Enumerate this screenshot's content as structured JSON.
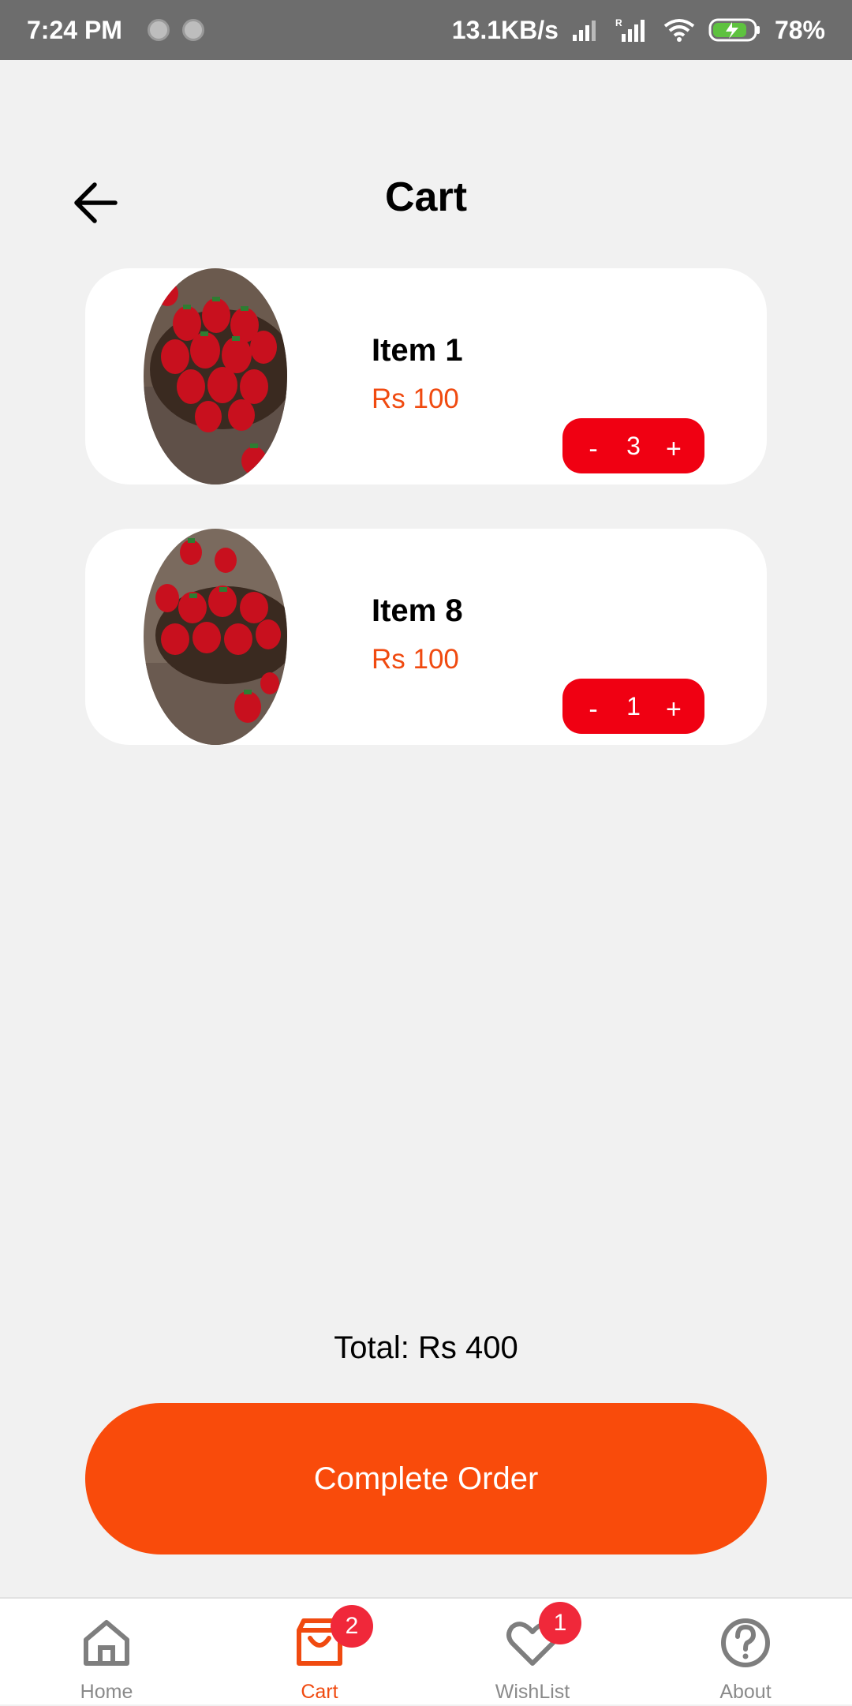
{
  "status_bar": {
    "time": "7:24 PM",
    "net_speed": "13.1KB/s",
    "battery": "78%"
  },
  "header": {
    "title": "Cart",
    "back_icon": "arrow-left-icon"
  },
  "cart_items": [
    {
      "name": "Item 1",
      "price": "Rs 100",
      "qty": "3",
      "minus": "-",
      "plus": "+",
      "image": "strawberries-photo"
    },
    {
      "name": "Item 8",
      "price": "Rs 100",
      "qty": "1",
      "minus": "-",
      "plus": "+",
      "image": "strawberries-photo"
    }
  ],
  "summary": {
    "total": "Total: Rs 400",
    "complete_label": "Complete Order"
  },
  "bottom_nav": {
    "items": [
      {
        "label": "Home",
        "icon": "home-icon",
        "active": false
      },
      {
        "label": "Cart",
        "icon": "cart-icon",
        "active": true,
        "badge": "2"
      },
      {
        "label": "WishList",
        "icon": "heart-icon",
        "active": false,
        "badge": "1"
      },
      {
        "label": "About",
        "icon": "help-icon",
        "active": false
      }
    ]
  },
  "colors": {
    "accent": "#f94b0b",
    "price": "#f04a10",
    "stepper": "#f00012",
    "badge": "#f0283a"
  }
}
